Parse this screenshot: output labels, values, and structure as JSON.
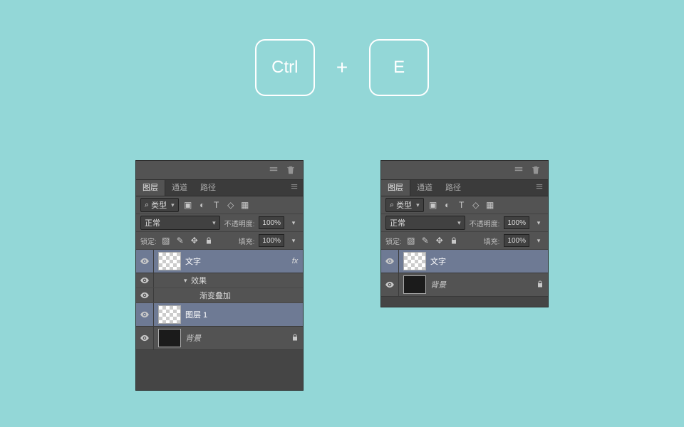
{
  "shortcut": {
    "key1": "Ctrl",
    "sep": "+",
    "key2": "E"
  },
  "common": {
    "tabs": {
      "layers": "图层",
      "channels": "通道",
      "paths": "路径"
    },
    "search_icon": "⌕",
    "type_label": "类型",
    "blend_mode": "正常",
    "opacity_label": "不透明度:",
    "opacity_value": "100%",
    "lock_label": "锁定:",
    "fill_label": "填充:",
    "fill_value": "100%",
    "fx_label": "fx",
    "lock_icon": "🔒"
  },
  "panels": {
    "left": {
      "layers": [
        {
          "name": "文字",
          "selected": true,
          "fx": true
        },
        {
          "sub": true,
          "name": "效果"
        },
        {
          "sub": true,
          "name": "渐变叠加",
          "indent": 1
        },
        {
          "name": "图层 1",
          "selected": true
        },
        {
          "name": "背景",
          "dark": true,
          "locked": true
        }
      ],
      "empty_height": 56
    },
    "right": {
      "layers": [
        {
          "name": "文字",
          "selected": true
        },
        {
          "name": "背景",
          "dark": true,
          "locked": true
        }
      ],
      "empty_height": 14
    }
  }
}
